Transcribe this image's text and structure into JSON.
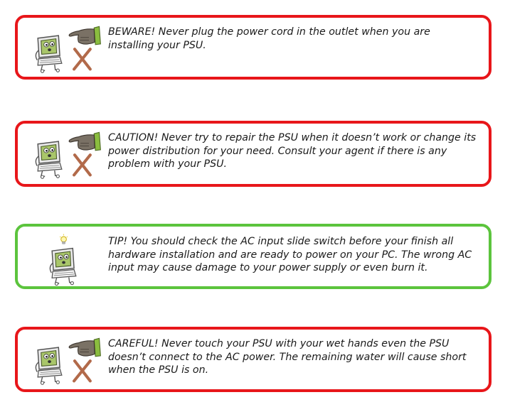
{
  "notices": [
    {
      "kind": "beware",
      "icon": "computer-stop-hand-icon",
      "text": "BEWARE! Never plug the power cord in the outlet when you are installing your PSU."
    },
    {
      "kind": "caution",
      "icon": "computer-stop-hand-icon",
      "text": "CAUTION! Never try to repair the PSU when it doesn’t work or change its power distribution for your need. Consult your agent if there is any problem with your PSU."
    },
    {
      "kind": "tip",
      "icon": "computer-lightbulb-icon",
      "text": "TIP! You should check the AC input slide switch before your finish all hardware installation and are ready to power on your PC. The wrong AC input may cause damage to your power supply or even burn it."
    },
    {
      "kind": "careful",
      "icon": "computer-stop-hand-icon",
      "text": "CAREFUL! Never touch your PSU with your wet hands even the PSU doesn’t connect to the AC power. The remaining water will cause short when the PSU is on."
    }
  ],
  "colors": {
    "warning_border": "#e8161a",
    "tip_border": "#5cc43d"
  }
}
